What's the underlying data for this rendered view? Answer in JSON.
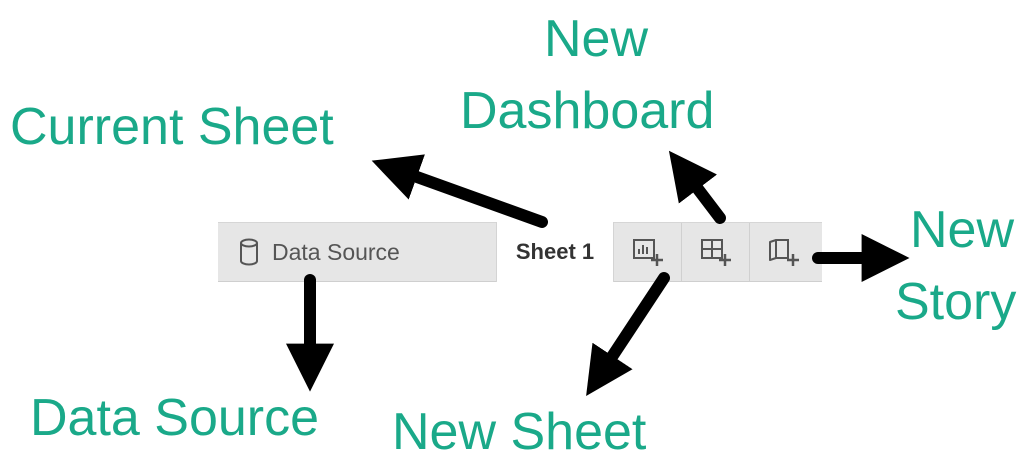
{
  "annotations": {
    "current_sheet": "Current Sheet",
    "new_dashboard_line1": "New",
    "new_dashboard_line2": "Dashboard",
    "new_story_line1": "New",
    "new_story_line2": "Story",
    "data_source": "Data Source",
    "new_sheet": "New Sheet"
  },
  "tabbar": {
    "data_source_label": "Data Source",
    "data_source_icon": "database-icon",
    "sheet_label": "Sheet 1",
    "new_sheet_icon": "new-worksheet-icon",
    "new_dashboard_icon": "new-dashboard-icon",
    "new_story_icon": "new-story-icon"
  },
  "colors": {
    "annotation": "#1aa989",
    "arrow": "#000000",
    "tabbar_bg": "#e6e6e6",
    "active_tab_bg": "#ffffff"
  }
}
